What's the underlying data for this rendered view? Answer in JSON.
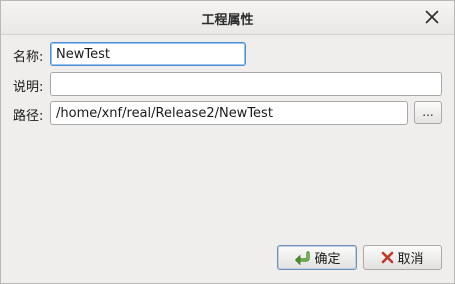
{
  "dialog": {
    "title": "工程属性",
    "close_icon": "close-icon"
  },
  "form": {
    "name_label": "名称:",
    "name_value": "NewTest",
    "description_label": "说明:",
    "description_value": "",
    "path_label": "路径:",
    "path_value": "/home/xnf/real/Release2/NewTest",
    "browse_label": "..."
  },
  "buttons": {
    "ok_label": "确定",
    "ok_icon": "check-arrow-icon",
    "cancel_label": "取消",
    "cancel_icon": "red-x-icon"
  },
  "colors": {
    "focus_border": "#4a90d9",
    "ok_icon_green": "#5a9a3a",
    "cancel_icon_red": "#c0392b"
  }
}
